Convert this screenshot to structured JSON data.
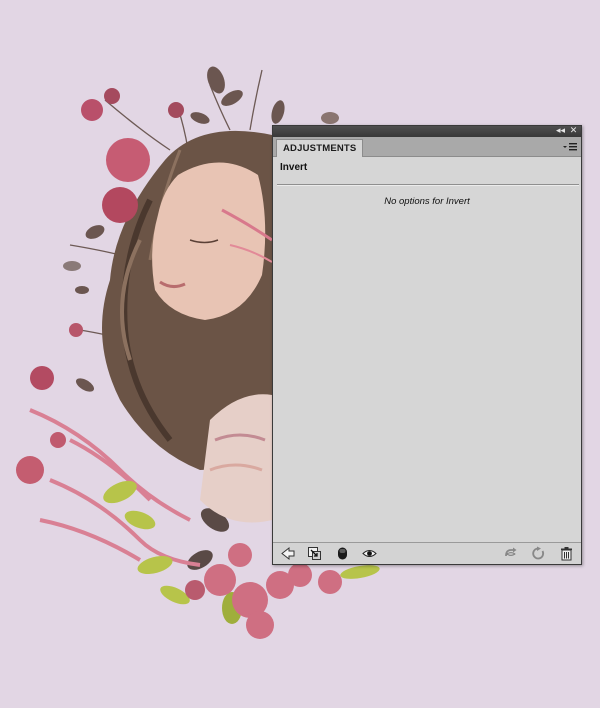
{
  "panel": {
    "tab_label": "ADJUSTMENTS",
    "adjustment_name": "Invert",
    "no_options_text": "No options for Invert"
  },
  "titlebar": {
    "collapse_glyph": "◂◂",
    "close_glyph": "✕"
  },
  "icons": {
    "bottom_left": [
      "back-arrow-icon",
      "clip-to-layer-icon",
      "mask-toggle-icon",
      "visibility-eye-icon"
    ],
    "bottom_right": [
      "view-previous-state-icon",
      "reset-icon",
      "trash-icon"
    ]
  },
  "colors": {
    "background": "#e2d6e4",
    "panel_bg": "#d6d6d6",
    "titlebar": "#3f3f3f",
    "flower_pink": "#c96a7c",
    "leaf_green": "#b7c44a",
    "hair_brown": "#6b5446"
  }
}
